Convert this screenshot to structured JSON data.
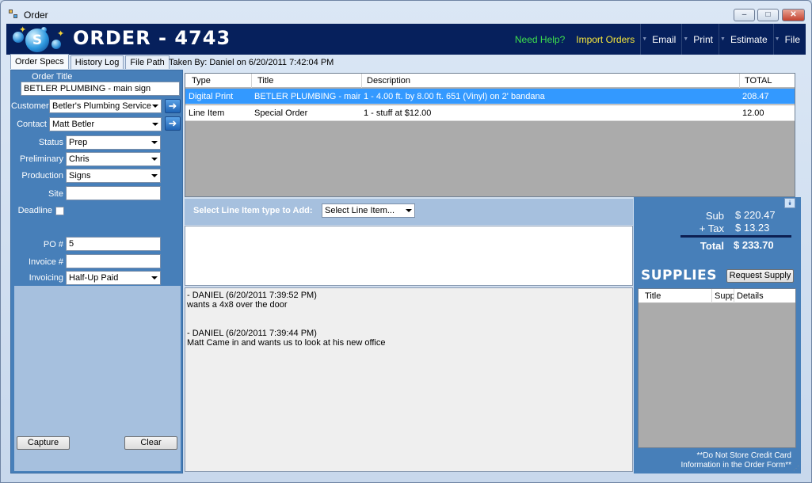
{
  "window": {
    "title": "Order",
    "buttons": {
      "minimize": "–",
      "maximize": "□",
      "close": "✕"
    }
  },
  "banner": {
    "logo_letter": "S",
    "order_title": "ORDER - 4743",
    "menu": [
      {
        "label": "Need Help?",
        "color": "#3ee04c"
      },
      {
        "label": "Import Orders",
        "color": "#f7e83c"
      },
      {
        "label": "Email"
      },
      {
        "label": "Print"
      },
      {
        "label": "Estimate"
      },
      {
        "label": "File"
      }
    ]
  },
  "tabs": [
    "Order Specs",
    "History Log",
    "File Path"
  ],
  "taken_by": "Taken By: Daniel on 6/20/2011 7:42:04 PM",
  "order_form": {
    "order_title_label": "Order Title",
    "order_title_value": "BETLER PLUMBING - main sign",
    "customer_label": "Customer",
    "customer_value": "Betler's Plumbing Service",
    "contact_label": "Contact",
    "contact_value": "Matt Betler",
    "status_label": "Status",
    "status_value": "Prep",
    "preliminary_label": "Preliminary",
    "preliminary_value": "Chris",
    "production_label": "Production",
    "production_value": "Signs",
    "site_label": "Site",
    "site_value": "",
    "deadline_label": "Deadline",
    "po_label": "PO #",
    "po_value": "5",
    "invoice_label": "Invoice #",
    "invoice_value": "",
    "invoicing_label": "Invoicing",
    "invoicing_value": "Half-Up Paid",
    "capture_button": "Capture",
    "clear_button": "Clear"
  },
  "line_items": {
    "columns": [
      "Type",
      "Title",
      "Description",
      "TOTAL"
    ],
    "rows": [
      {
        "type": "Digital Print",
        "title": "BETLER PLUMBING - main...",
        "description": "1 -  4.00 ft. by 8.00 ft. 651 (Vinyl) on 2' bandana",
        "total": "208.47",
        "selected": true
      },
      {
        "type": "Line Item",
        "title": "Special Order",
        "description": "1 - stuff at $12.00",
        "total": "12.00",
        "selected": false
      }
    ]
  },
  "add_line_item": {
    "label": "Select Line Item type to Add:",
    "select_value": "Select Line Item..."
  },
  "notes": [
    {
      "header": "- DANIEL (6/20/2011 7:39:52 PM)",
      "body": "wants a 4x8 over the door"
    },
    {
      "header": "- DANIEL (6/20/2011 7:39:44 PM)",
      "body": "Matt Came in and wants us to look at his new office"
    }
  ],
  "totals": {
    "sub_label": "Sub",
    "sub_value": "$ 220.47",
    "tax_label": "+ Tax",
    "tax_value": "$ 13.23",
    "total_label": "Total",
    "total_value": "$ 233.70"
  },
  "supplies": {
    "title": "SUPPLIES",
    "request_button": "Request Supply",
    "columns": [
      "Title",
      "Supp",
      "Details"
    ],
    "disclaimer_line1": "**Do Not Store Credit Card",
    "disclaimer_line2": "Information in the Order Form**"
  }
}
